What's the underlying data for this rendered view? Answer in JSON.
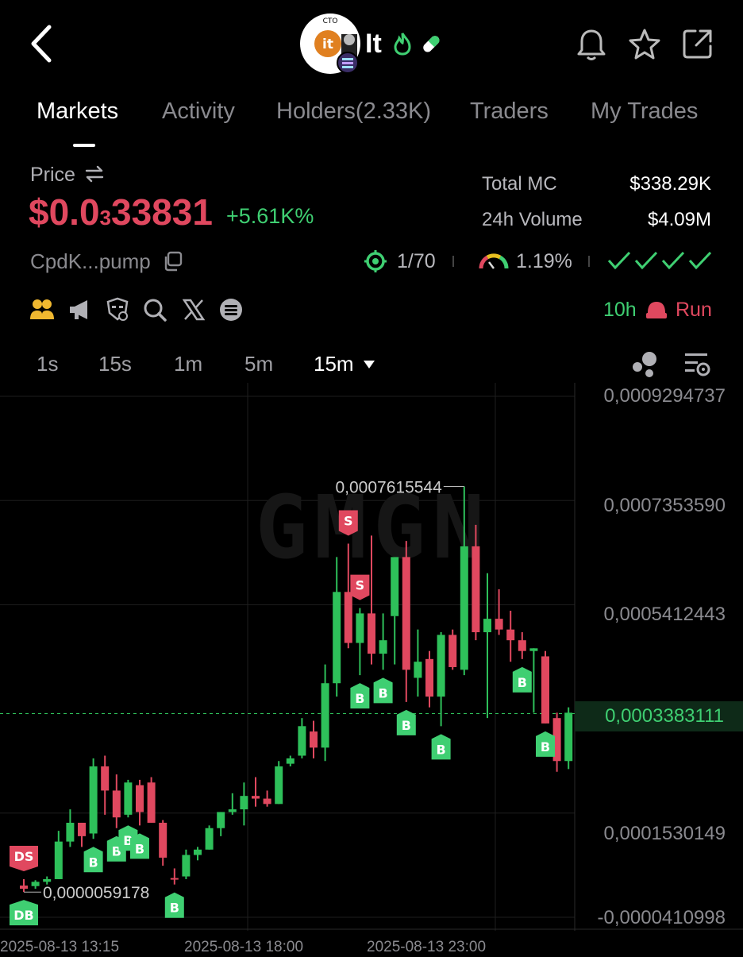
{
  "header": {
    "token_symbol": "It",
    "logo_badge": "CTO",
    "logo_letters": "it",
    "icons": [
      "back-arrow-icon",
      "fire-icon",
      "pill-icon",
      "bell-icon",
      "star-icon",
      "share-icon",
      "solana-icon"
    ]
  },
  "tabs": [
    {
      "label": "Markets",
      "active": true
    },
    {
      "label": "Activity",
      "active": false
    },
    {
      "label": "Holders(2.33K)",
      "active": false
    },
    {
      "label": "Traders",
      "active": false
    },
    {
      "label": "My Trades",
      "active": false
    }
  ],
  "price": {
    "label": "Price",
    "swap_icon": "swap-icon",
    "value_prefix": "$0.0",
    "value_zeros": "3",
    "value_digits": "33831",
    "change": "+5.61K%",
    "address": "CpdK...pump"
  },
  "stats": {
    "total_mc_label": "Total MC",
    "total_mc_value": "$338.29K",
    "volume_label": "24h Volume",
    "volume_value": "$4.09M",
    "target_value": "1/70",
    "gauge_value": "1.19%",
    "checks": 4
  },
  "social_icons": [
    "dev-icon",
    "megaphone-icon",
    "mask-icon",
    "search-icon",
    "x-icon",
    "telegram-icon"
  ],
  "age": {
    "value": "10h",
    "status": "Run",
    "status_icon": "cap-icon"
  },
  "timeframes": [
    {
      "label": "1s",
      "active": false
    },
    {
      "label": "15s",
      "active": false
    },
    {
      "label": "1m",
      "active": false
    },
    {
      "label": "5m",
      "active": false
    },
    {
      "label": "15m",
      "active": true
    }
  ],
  "chart_icons": [
    "indicator-dots-icon",
    "chart-settings-icon"
  ],
  "chart_data": {
    "type": "candlestick",
    "watermark": "GMGN",
    "y_labels": [
      "0,0009294737",
      "0,0007353590",
      "0,0005412443",
      "0,0003383111",
      "0,0001530149",
      "-0,0000410998"
    ],
    "y_ticks": [
      0.0009294737,
      0.000735359,
      0.0005412443,
      0.0003383111,
      0.0001530149,
      -4.10998e-05
    ],
    "current_price": 0.0003383111,
    "current_price_label": "0,0003383111",
    "max_annotation": {
      "label": "0,0007615544",
      "value": 0.0007615544
    },
    "min_annotation": {
      "label": "0,0000059178",
      "value": 5.9178e-06
    },
    "x_labels": [
      "2025-08-13 13:15",
      "2025-08-13 18:00",
      "2025-08-13 23:00"
    ],
    "up_color": "#2ec05a",
    "down_color": "#e0485f",
    "candles": [
      {
        "o": 1.8e-05,
        "h": 3e-05,
        "l": 6e-06,
        "c": 1.2e-05
      },
      {
        "o": 1.7e-05,
        "h": 2.8e-05,
        "l": 1.2e-05,
        "c": 2.5e-05
      },
      {
        "o": 2.5e-05,
        "h": 3.5e-05,
        "l": 2e-05,
        "c": 3e-05
      },
      {
        "o": 3e-05,
        "h": 0.00012,
        "l": 3e-05,
        "c": 0.0001
      },
      {
        "o": 0.0001,
        "h": 0.00016,
        "l": 9e-05,
        "c": 0.000135
      },
      {
        "o": 0.000135,
        "h": 0.000135,
        "l": 9e-05,
        "c": 0.00011
      },
      {
        "o": 0.000115,
        "h": 0.000255,
        "l": 0.000105,
        "c": 0.00024
      },
      {
        "o": 0.00024,
        "h": 0.00026,
        "l": 0.00015,
        "c": 0.000195
      },
      {
        "o": 0.000195,
        "h": 0.000225,
        "l": 0.000125,
        "c": 0.000145
      },
      {
        "o": 0.00015,
        "h": 0.000215,
        "l": 0.000145,
        "c": 0.00021
      },
      {
        "o": 0.000205,
        "h": 0.000215,
        "l": 0.00013,
        "c": 0.000155
      },
      {
        "o": 0.00021,
        "h": 0.00022,
        "l": 0.000135,
        "c": 0.000135
      },
      {
        "o": 0.000135,
        "h": 0.00014,
        "l": 5.5e-05,
        "c": 7e-05
      },
      {
        "o": 3.2e-05,
        "h": 5e-05,
        "l": 2e-05,
        "c": 3e-05
      },
      {
        "o": 3.5e-05,
        "h": 8.5e-05,
        "l": 3e-05,
        "c": 7.5e-05
      },
      {
        "o": 7.5e-05,
        "h": 9e-05,
        "l": 6.5e-05,
        "c": 8.5e-05
      },
      {
        "o": 8.5e-05,
        "h": 0.00013,
        "l": 8.5e-05,
        "c": 0.000125
      },
      {
        "o": 0.000125,
        "h": 0.000155,
        "l": 0.00011,
        "c": 0.000155
      },
      {
        "o": 0.000155,
        "h": 0.00019,
        "l": 0.00015,
        "c": 0.00016
      },
      {
        "o": 0.00016,
        "h": 0.00021,
        "l": 0.00013,
        "c": 0.000185
      },
      {
        "o": 0.000185,
        "h": 0.00022,
        "l": 0.000165,
        "c": 0.00018
      },
      {
        "o": 0.00018,
        "h": 0.000195,
        "l": 0.000165,
        "c": 0.00017
      },
      {
        "o": 0.00017,
        "h": 0.00025,
        "l": 0.00017,
        "c": 0.00024
      },
      {
        "o": 0.000245,
        "h": 0.00026,
        "l": 0.00024,
        "c": 0.000255
      },
      {
        "o": 0.00026,
        "h": 0.00033,
        "l": 0.000255,
        "c": 0.000315
      },
      {
        "o": 0.000305,
        "h": 0.000325,
        "l": 0.000255,
        "c": 0.000275
      },
      {
        "o": 0.000275,
        "h": 0.00043,
        "l": 0.00025,
        "c": 0.000395
      },
      {
        "o": 0.000395,
        "h": 0.00063,
        "l": 0.00037,
        "c": 0.000565
      },
      {
        "o": 0.000565,
        "h": 0.000655,
        "l": 0.00046,
        "c": 0.00047
      },
      {
        "o": 0.00047,
        "h": 0.000535,
        "l": 0.00041,
        "c": 0.000525
      },
      {
        "o": 0.000525,
        "h": 0.00067,
        "l": 0.00043,
        "c": 0.00045
      },
      {
        "o": 0.00045,
        "h": 0.000525,
        "l": 0.00042,
        "c": 0.000475
      },
      {
        "o": 0.00052,
        "h": 0.00052,
        "l": 0.00043,
        "c": 0.00063
      },
      {
        "o": 0.00063,
        "h": 0.00066,
        "l": 0.00036,
        "c": 0.00042
      },
      {
        "o": 0.000405,
        "h": 0.000495,
        "l": 0.00037,
        "c": 0.000435
      },
      {
        "o": 0.00044,
        "h": 0.000455,
        "l": 0.00035,
        "c": 0.00037
      },
      {
        "o": 0.00037,
        "h": 0.00049,
        "l": 0.000315,
        "c": 0.000485
      },
      {
        "o": 0.000485,
        "h": 0.000495,
        "l": 0.00042,
        "c": 0.000425
      },
      {
        "o": 0.00042,
        "h": 0.0007615544,
        "l": 0.00041,
        "c": 0.00065
      },
      {
        "o": 0.00065,
        "h": 0.00069,
        "l": 0.000475,
        "c": 0.00049
      },
      {
        "o": 0.00049,
        "h": 0.0006,
        "l": 0.00033,
        "c": 0.000515
      },
      {
        "o": 0.000515,
        "h": 0.00057,
        "l": 0.000485,
        "c": 0.000495
      },
      {
        "o": 0.000495,
        "h": 0.00053,
        "l": 0.000435,
        "c": 0.000475
      },
      {
        "o": 0.000475,
        "h": 0.00049,
        "l": 0.00044,
        "c": 0.000455
      },
      {
        "o": 0.000455,
        "h": 0.00046,
        "l": 0.00034,
        "c": 0.00046
      },
      {
        "o": 0.000445,
        "h": 0.000455,
        "l": 0.00032,
        "c": 0.00032
      },
      {
        "o": 0.00033,
        "h": 0.00034,
        "l": 0.00023,
        "c": 0.00025
      },
      {
        "o": 0.00025,
        "h": 0.00035,
        "l": 0.000235,
        "c": 0.00034
      },
      {
        "o": 0.000335,
        "h": 0.00036,
        "l": 0.00033,
        "c": 0.0003383
      }
    ],
    "markers": [
      {
        "text": "DS",
        "type": "sell",
        "candle": 0,
        "pos": "above"
      },
      {
        "text": "DB",
        "type": "buy",
        "candle": 0,
        "pos": "below"
      },
      {
        "text": "B",
        "type": "buy",
        "candle": 6,
        "pos": "below"
      },
      {
        "text": "B",
        "type": "buy",
        "candle": 8,
        "pos": "below"
      },
      {
        "text": "B",
        "type": "buy",
        "candle": 9,
        "pos": "below"
      },
      {
        "text": "B",
        "type": "buy",
        "candle": 10,
        "pos": "below"
      },
      {
        "text": "B",
        "type": "buy",
        "candle": 13,
        "pos": "below"
      },
      {
        "text": "S",
        "type": "sell",
        "candle": 28,
        "pos": "above"
      },
      {
        "text": "S",
        "type": "sell",
        "candle": 29,
        "pos": "above"
      },
      {
        "text": "B",
        "type": "buy",
        "candle": 31,
        "pos": "below"
      },
      {
        "text": "B",
        "type": "buy",
        "candle": 29,
        "pos": "below"
      },
      {
        "text": "B",
        "type": "buy",
        "candle": 33,
        "pos": "below"
      },
      {
        "text": "B",
        "type": "buy",
        "candle": 36,
        "pos": "below"
      },
      {
        "text": "B",
        "type": "buy",
        "candle": 43,
        "pos": "below"
      },
      {
        "text": "B",
        "type": "buy",
        "candle": 45,
        "pos": "below"
      }
    ]
  }
}
